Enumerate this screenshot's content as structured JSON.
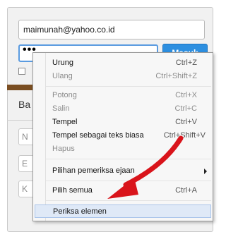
{
  "login": {
    "email_value": "maimunah@yahoo.co.id",
    "password_value": "•••",
    "login_button_label": "Masuk"
  },
  "section": {
    "header_partial": "Ba"
  },
  "side_fields": [
    "N",
    "E",
    "K"
  ],
  "context_menu": {
    "items": [
      {
        "label": "Urung",
        "shortcut": "Ctrl+Z",
        "enabled": true
      },
      {
        "label": "Ulang",
        "shortcut": "Ctrl+Shift+Z",
        "enabled": false
      },
      {
        "label": "Potong",
        "shortcut": "Ctrl+X",
        "enabled": false
      },
      {
        "label": "Salin",
        "shortcut": "Ctrl+C",
        "enabled": false
      },
      {
        "label": "Tempel",
        "shortcut": "Ctrl+V",
        "enabled": true
      },
      {
        "label": "Tempel sebagai teks biasa",
        "shortcut": "Ctrl+Shift+V",
        "enabled": true
      },
      {
        "label": "Hapus",
        "shortcut": "",
        "enabled": false
      },
      {
        "label": "Pilihan pemeriksa ejaan",
        "shortcut": "",
        "enabled": true,
        "submenu": true
      },
      {
        "label": "Pilih semua",
        "shortcut": "Ctrl+A",
        "enabled": true
      },
      {
        "label": "Periksa elemen",
        "shortcut": "",
        "enabled": true,
        "highlighted": true
      }
    ]
  },
  "colors": {
    "annotation_arrow": "#d9141b",
    "login_button": "#2d8fe0",
    "menu_highlight": "#dfe9f7"
  },
  "icons": [
    "chevron-right-icon",
    "annotation-arrow-icon"
  ]
}
